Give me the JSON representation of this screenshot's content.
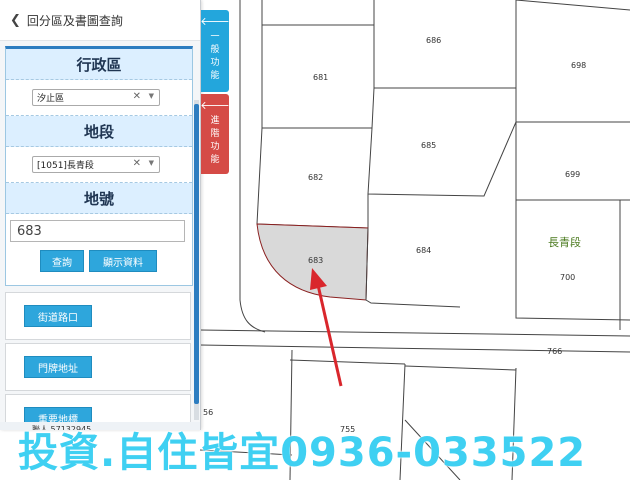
{
  "panel": {
    "header_title": "回分區及書圖查詢",
    "back_icon": "chevron-left-icon",
    "district": {
      "heading": "行政區",
      "selected": "汐止區"
    },
    "section": {
      "heading": "地段",
      "selected": "[1051]長青段"
    },
    "lot": {
      "heading": "地號",
      "value": "683"
    },
    "buttons": {
      "query": "查詢",
      "show_data": "顯示資料"
    },
    "cards": [
      {
        "label": "街道路口"
      },
      {
        "label": "門牌地址"
      },
      {
        "label": "重要地標"
      }
    ],
    "status_text": "聯人 57132945"
  },
  "side_tabs": {
    "basic": {
      "chars": [
        "一",
        "般",
        "功",
        "能"
      ],
      "icon": "arrow-left-icon"
    },
    "advanced": {
      "chars": [
        "進",
        "階",
        "功",
        "能"
      ],
      "icon": "arrow-left-icon"
    }
  },
  "map": {
    "parcels": {
      "p686": "686",
      "p681": "681",
      "p698": "698",
      "p685": "685",
      "p682": "682",
      "p699": "699",
      "p683": "683",
      "p684": "684",
      "p700": "700",
      "p766": "766",
      "p56": "56",
      "p755": "755"
    },
    "section_label": "長青段",
    "highlight_color": "#d9d9d9",
    "arrow_color": "#d9262c"
  },
  "watermark": "投資.自住皆宜0936-033522"
}
